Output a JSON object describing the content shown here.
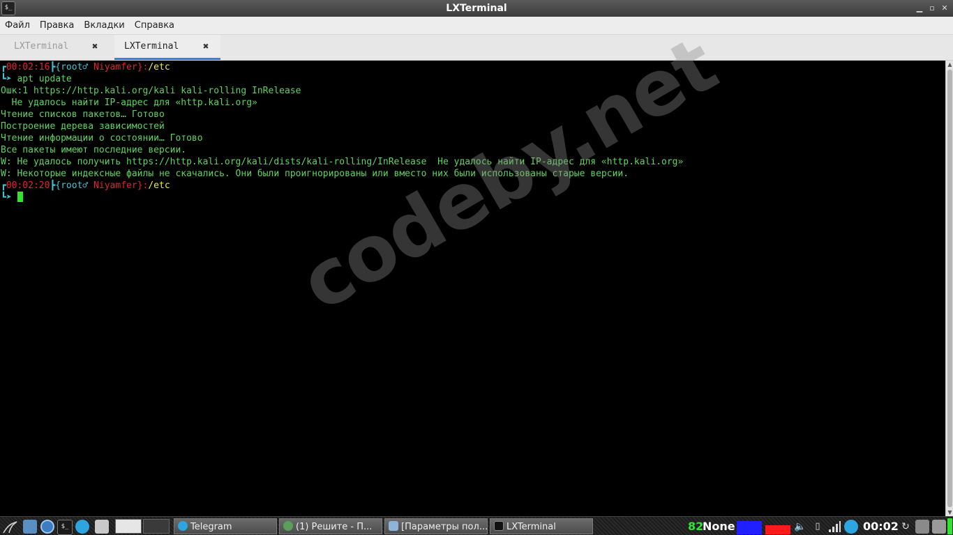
{
  "window": {
    "title": "LXTerminal",
    "app_icon_glyph": "$_"
  },
  "menu": [
    "Файл",
    "Правка",
    "Вкладки",
    "Справка"
  ],
  "tabs": [
    {
      "label": "LXTerminal",
      "close": "✖",
      "active": false
    },
    {
      "label": "LXTerminal",
      "close": "✖",
      "active": true
    }
  ],
  "terminal": {
    "prompt1": {
      "bracket_open": "┏",
      "time": "00:02:16",
      "sep": "┣",
      "user_open": "{root",
      "gender": "♂",
      "host": "Niyamfer",
      "user_close": "}:",
      "path": "/etc"
    },
    "cmd1_prefix": "┗➤",
    "cmd1": " apt update",
    "output": [
      "Ошк:1 https://http.kali.org/kali kali-rolling InRelease",
      "  Не удалось найти IP-адрес для «http.kali.org»",
      "Чтение списков пакетов… Готово",
      "Построение дерева зависимостей",
      "Чтение информации о состоянии… Готово",
      "Все пакеты имеют последние версии.",
      "W: Не удалось получить https://http.kali.org/kali/dists/kali-rolling/InRelease  Не удалось найти IP-адрес для «http.kali.org»",
      "W: Некоторые индексные файлы не скачались. Они были проигнорированы или вместо них были использованы старые версии."
    ],
    "prompt2": {
      "bracket_open": "┏",
      "time": "00:02:20",
      "sep": "┣",
      "user_open": "{root",
      "gender": "♂",
      "host": "Niyamfer",
      "user_close": "}:",
      "path": "/etc"
    },
    "cmd2_prefix": "┗➤"
  },
  "watermark": "codeby.net",
  "taskbar": {
    "tasks": [
      {
        "label": "Telegram",
        "icon": "telegram-icon"
      },
      {
        "label": "(1) Решите - П...",
        "icon": "browser-icon"
      },
      {
        "label": "[Параметры пол...",
        "icon": "settings-icon"
      },
      {
        "label": "LXTerminal",
        "icon": "terminal-icon"
      }
    ],
    "cpu_value": "82",
    "net_label": "None",
    "clock": "00:02"
  },
  "colors": {
    "terminal_green": "#5fd35f",
    "prompt_red": "#e8202e",
    "prompt_cyan": "#3fc7d6",
    "path_yellow": "#ecec3a",
    "tab_accent": "#3b7ed6"
  }
}
